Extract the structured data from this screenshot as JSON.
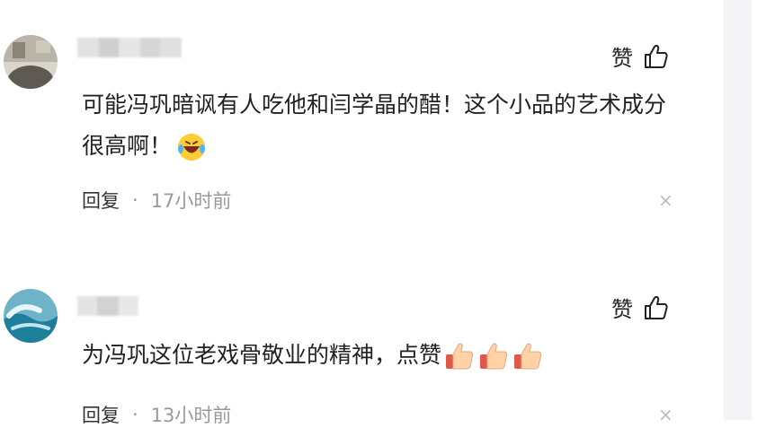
{
  "comments": [
    {
      "like_label": "赞",
      "text": "可能冯巩暗讽有人吃他和闫学晶的醋！这个小品的艺术成分很高啊！",
      "reply_label": "回复",
      "separator": "·",
      "time": "17小时前",
      "close_glyph": "×"
    },
    {
      "like_label": "赞",
      "text": "为冯巩这位老戏骨敬业的精神，点赞",
      "reply_label": "回复",
      "separator": "·",
      "time": "13小时前",
      "close_glyph": "×"
    }
  ],
  "colors": {
    "text": "#222222",
    "meta": "#999999",
    "scrollbar": "#f4f4f6"
  },
  "icons": [
    "thumbs-up-outline-icon",
    "laughing-tears-emoji",
    "thumbs-up-emoji",
    "close-icon"
  ]
}
